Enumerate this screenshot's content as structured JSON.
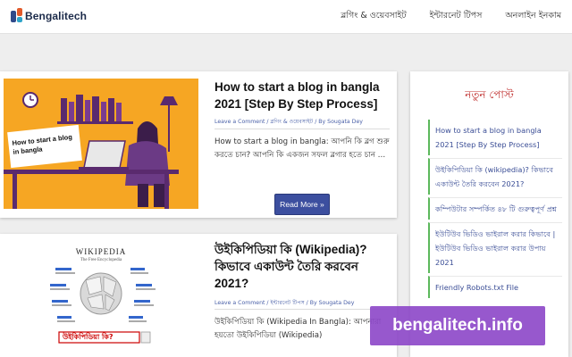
{
  "header": {
    "logo_text": "Bengalitech",
    "nav": [
      "ব্লগিং & ওয়েবসাইট",
      "ইন্টারনেট টিপস",
      "অনলাইন ইনকাম"
    ]
  },
  "posts": [
    {
      "thumb_caption": "How to start a blog in bangla",
      "title": "How to start a blog in bangla 2021 [Step By Step Process]",
      "meta": "Leave a Comment / ব্লগিং & ওয়েবসাইট / By Sougata Dey",
      "excerpt": "How to start a blog in bangla: আপনি কি ব্লগ শুরু করতে চান? আপনি কি একজন সফল ব্লগার হতে চান …",
      "read_more": "Read More »"
    },
    {
      "thumb_caption": "উইকিপিডিয়া কি?",
      "thumb_wordmark": "WIKIPEDIA",
      "thumb_tagline": "The Free Encyclopedia",
      "title": "উইকিপিডিয়া কি (Wikipedia)? কিভাবে একাউন্ট তৈরি করবেন 2021?",
      "meta": "Leave a Comment / ইন্টারনেট টিপস / By Sougata Dey",
      "excerpt": "উইকিপিডিয়া কি (Wikipedia In Bangla): আপনারা হয়তো উইকিপিডিয়া (Wikipedia)"
    }
  ],
  "sidebar": {
    "title": "নতুন পোস্ট",
    "items": [
      "How to start a blog in bangla 2021 [Step By Step Process]",
      "উইকিপিডিয়া কি (wikipedia)? কিভাবে একাউন্ট তৈরি করবেন 2021?",
      "কম্পিউটার সম্পর্কিত ৪৮ টি গুরুত্বপূর্ণ প্রশ্ন",
      "ইউটিউব ভিডিও ভাইরাল করার কিভাবে | ইউটিউব ভিডিও ভাইরাল করার উপায় 2021",
      "Friendly Robots.txt File"
    ]
  },
  "watermark": "bengalitech.info",
  "colors": {
    "accent": "#3c4f9f",
    "sidebar_bar": "#5cb85c",
    "sidebar_title": "#c0302f",
    "watermark": "#8c46c8"
  }
}
